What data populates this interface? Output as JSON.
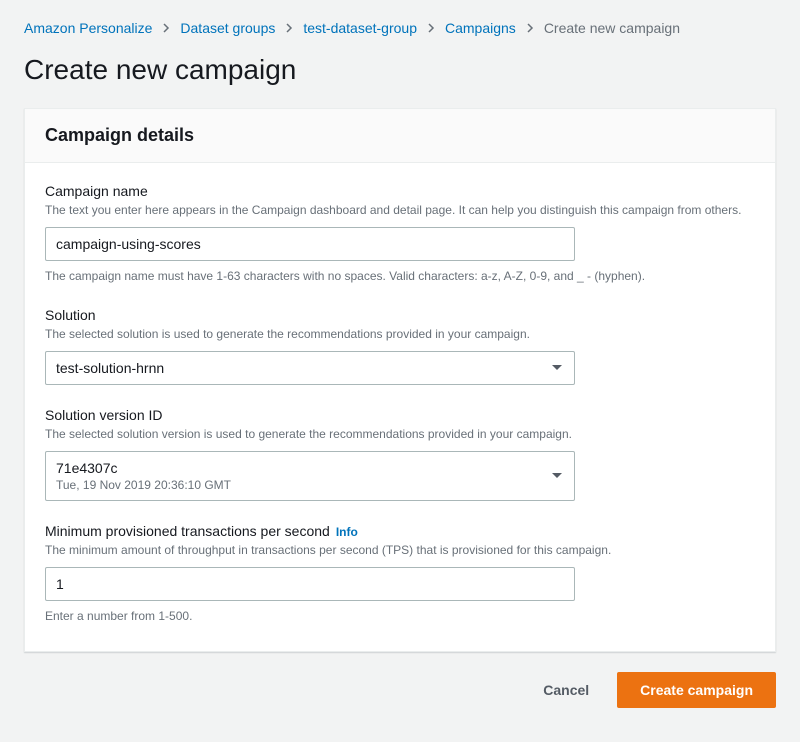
{
  "breadcrumb": {
    "items": [
      {
        "label": "Amazon Personalize",
        "link": true
      },
      {
        "label": "Dataset groups",
        "link": true
      },
      {
        "label": "test-dataset-group",
        "link": true
      },
      {
        "label": "Campaigns",
        "link": true
      },
      {
        "label": "Create new campaign",
        "link": false
      }
    ]
  },
  "page": {
    "title": "Create new campaign"
  },
  "panel": {
    "title": "Campaign details"
  },
  "fields": {
    "name": {
      "label": "Campaign name",
      "desc": "The text you enter here appears in the Campaign dashboard and detail page. It can help you distinguish this campaign from others.",
      "value": "campaign-using-scores",
      "hint": "The campaign name must have 1-63 characters with no spaces. Valid characters: a-z, A-Z, 0-9, and _ - (hyphen)."
    },
    "solution": {
      "label": "Solution",
      "desc": "The selected solution is used to generate the recommendations provided in your campaign.",
      "value": "test-solution-hrnn"
    },
    "version": {
      "label": "Solution version ID",
      "desc": "The selected solution version is used to generate the recommendations provided in your campaign.",
      "value": "71e4307c",
      "sub": "Tue, 19 Nov 2019 20:36:10 GMT"
    },
    "tps": {
      "label": "Minimum provisioned transactions per second",
      "info": "Info",
      "desc": "The minimum amount of throughput in transactions per second (TPS) that is provisioned for this campaign.",
      "value": "1",
      "hint": "Enter a number from 1-500."
    }
  },
  "actions": {
    "cancel": "Cancel",
    "submit": "Create campaign"
  }
}
